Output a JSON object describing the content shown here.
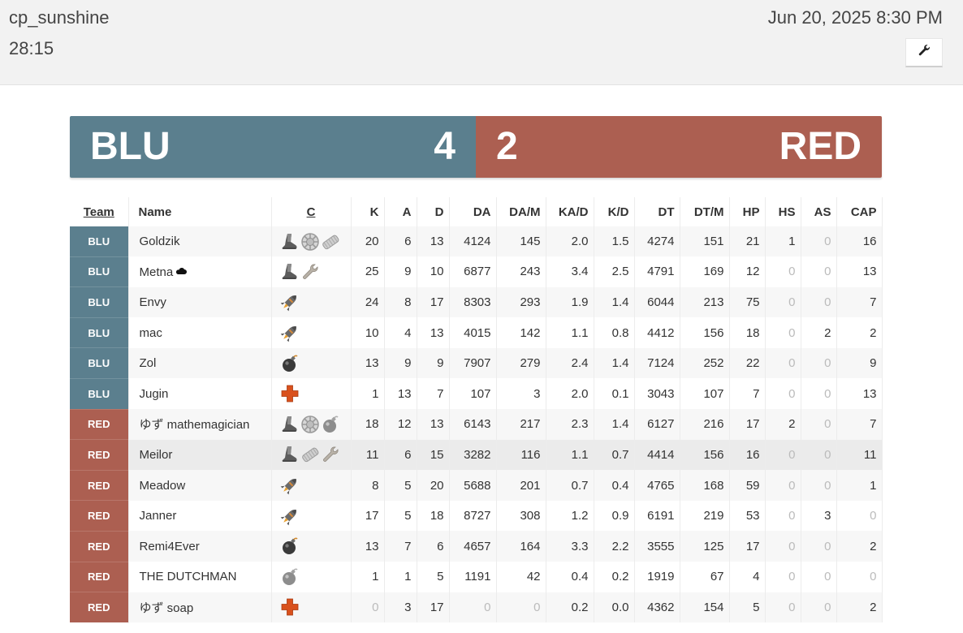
{
  "header": {
    "map": "cp_sunshine",
    "duration": "28:15",
    "date": "Jun 20, 2025 8:30 PM",
    "settings_icon": "wrench-icon"
  },
  "score": {
    "blu": {
      "name": "BLU",
      "score": "4",
      "color": "#5b7f8e"
    },
    "red": {
      "name": "RED",
      "score": "2",
      "color": "#ac5f51"
    }
  },
  "table": {
    "columns": [
      "Team",
      "Name",
      "C",
      "K",
      "A",
      "D",
      "DA",
      "DA/M",
      "KA/D",
      "K/D",
      "DT",
      "DT/M",
      "HP",
      "HS",
      "AS",
      "CAP"
    ],
    "rows": [
      {
        "team": "BLU",
        "name": "Goldzik",
        "classes": [
          "boots-icon",
          "medigun-icon",
          "medkit-pack-icon"
        ],
        "stats": [
          "20",
          "6",
          "13",
          "4124",
          "145",
          "2.0",
          "1.5",
          "4274",
          "151",
          "21",
          "1",
          "0",
          "16"
        ]
      },
      {
        "team": "BLU",
        "name": "Metna",
        "name_icon": "cloud-icon",
        "classes": [
          "boots-icon",
          "wrench-icon"
        ],
        "stats": [
          "25",
          "9",
          "10",
          "6877",
          "243",
          "3.4",
          "2.5",
          "4791",
          "169",
          "12",
          "0",
          "0",
          "13"
        ]
      },
      {
        "team": "BLU",
        "name": "Envy",
        "classes": [
          "rocket-icon"
        ],
        "stats": [
          "24",
          "8",
          "17",
          "8303",
          "293",
          "1.9",
          "1.4",
          "6044",
          "213",
          "75",
          "0",
          "0",
          "7"
        ]
      },
      {
        "team": "BLU",
        "name": "mac",
        "classes": [
          "rocket-icon"
        ],
        "stats": [
          "10",
          "4",
          "13",
          "4015",
          "142",
          "1.1",
          "0.8",
          "4412",
          "156",
          "18",
          "0",
          "2",
          "2"
        ]
      },
      {
        "team": "BLU",
        "name": "Zol",
        "classes": [
          "bomb-icon"
        ],
        "stats": [
          "13",
          "9",
          "9",
          "7907",
          "279",
          "2.4",
          "1.4",
          "7124",
          "252",
          "22",
          "0",
          "0",
          "9"
        ]
      },
      {
        "team": "BLU",
        "name": "Jugin",
        "classes": [
          "medic-cross-icon"
        ],
        "stats": [
          "1",
          "13",
          "7",
          "107",
          "3",
          "2.0",
          "0.1",
          "3043",
          "107",
          "7",
          "0",
          "0",
          "13"
        ]
      },
      {
        "team": "RED",
        "name": "ゆず mathemagician",
        "classes": [
          "boots-icon",
          "medigun-icon",
          "bomb-gray-icon"
        ],
        "stats": [
          "18",
          "12",
          "13",
          "6143",
          "217",
          "2.3",
          "1.4",
          "6127",
          "216",
          "17",
          "2",
          "0",
          "7"
        ]
      },
      {
        "team": "RED",
        "name": "Meilor",
        "classes": [
          "boots-icon",
          "medkit-pack-icon",
          "wrench-icon"
        ],
        "stats": [
          "11",
          "6",
          "15",
          "3282",
          "116",
          "1.1",
          "0.7",
          "4414",
          "156",
          "16",
          "0",
          "0",
          "11"
        ]
      },
      {
        "team": "RED",
        "name": "Meadow",
        "classes": [
          "rocket-icon"
        ],
        "stats": [
          "8",
          "5",
          "20",
          "5688",
          "201",
          "0.7",
          "0.4",
          "4765",
          "168",
          "59",
          "0",
          "0",
          "1"
        ]
      },
      {
        "team": "RED",
        "name": "Janner",
        "classes": [
          "rocket-icon"
        ],
        "stats": [
          "17",
          "5",
          "18",
          "8727",
          "308",
          "1.2",
          "0.9",
          "6191",
          "219",
          "53",
          "0",
          "3",
          "0"
        ]
      },
      {
        "team": "RED",
        "name": "Remi4Ever",
        "classes": [
          "bomb-icon"
        ],
        "stats": [
          "13",
          "7",
          "6",
          "4657",
          "164",
          "3.3",
          "2.2",
          "3555",
          "125",
          "17",
          "0",
          "0",
          "2"
        ]
      },
      {
        "team": "RED",
        "name": "THE DUTCHMAN",
        "classes": [
          "bomb-gray-icon"
        ],
        "stats": [
          "1",
          "1",
          "5",
          "1191",
          "42",
          "0.4",
          "0.2",
          "1919",
          "67",
          "4",
          "0",
          "0",
          "0"
        ]
      },
      {
        "team": "RED",
        "name": "ゆず soap",
        "classes": [
          "medic-cross-icon"
        ],
        "stats": [
          "0",
          "3",
          "17",
          "0",
          "0",
          "0.2",
          "0.0",
          "4362",
          "154",
          "5",
          "0",
          "0",
          "2"
        ]
      }
    ]
  }
}
